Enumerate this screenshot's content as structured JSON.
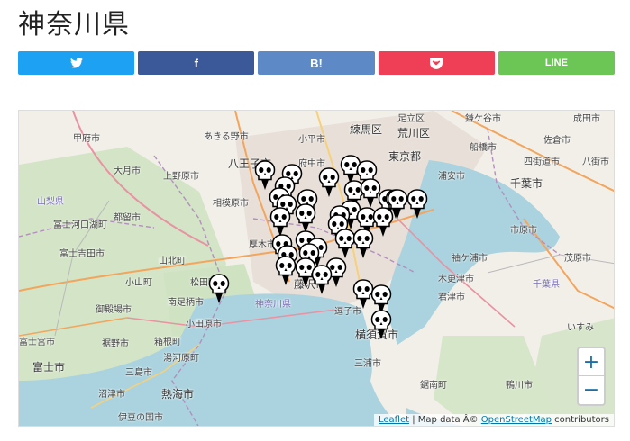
{
  "page": {
    "title": "神奈川県"
  },
  "share": {
    "twitter_label": "",
    "facebook_label": "f",
    "hatena_label": "B!",
    "pocket_label": "",
    "line_label": "LINE"
  },
  "map": {
    "zoom_in": "+",
    "zoom_out": "−",
    "attribution": {
      "leaflet": "Leaflet",
      "sep": " | Map data Â© ",
      "osm": "OpenStreetMap",
      "suffix": " contributors"
    },
    "labels": {
      "kofu": "甲府市",
      "akiruno": "あきる野市",
      "nerima": "練馬区",
      "adachi": "足立区",
      "kamagaya": "鎌ケ谷市",
      "narita": "成田市",
      "kodaira": "小平市",
      "arakawa": "荒川区",
      "hachioji": "八王子市",
      "fuchu": "府中市",
      "tokyo": "東京都",
      "funabashi": "船橋市",
      "sakura": "佐倉市",
      "otsuki": "大月市",
      "uenohara": "上野原市",
      "urayasu": "浦安市",
      "yotsukaido": "四街道市",
      "yachimata": "八街市",
      "chiba": "千葉市",
      "sagamihara": "相模原市",
      "yamanashi": "山梨県",
      "tsuru": "都留市",
      "fujikawaguchiko": "富士河口湖町",
      "fujiyoshida": "富士吉田市",
      "atsugi": "厚木市",
      "ichihara": "市原市",
      "sodegaura": "袖ケ浦市",
      "kisarazu": "木更津市",
      "mobara": "茂原市",
      "yamakita": "山北町",
      "matsuda": "松田町",
      "oyama": "小山町",
      "minamiashigara": "南足柄市",
      "fujisawa": "藤沢市",
      "kimitsu": "君津市",
      "chiba_pref": "千葉県",
      "gotemba": "御殿場市",
      "odawara": "小田原市",
      "kanagawa_pref": "神奈川県",
      "zushi": "逗子市",
      "isumi": "いすみ",
      "yokosuka": "横須賀市",
      "fujinomiya": "富士宮市",
      "susono": "裾野市",
      "hakone": "箱根町",
      "yugawara": "湯河原町",
      "fuji": "富士市",
      "miura": "三浦市",
      "mishima": "三島市",
      "numazu": "沼津市",
      "atami": "熱海市",
      "kamogawa": "鴨川市",
      "minamiboso": "鋸南町",
      "izunokuni": "伊豆の国市"
    },
    "markers": [
      "skull",
      "skull",
      "skull",
      "skull",
      "skull",
      "skull",
      "skull",
      "skull",
      "skull",
      "skull",
      "skull",
      "skull",
      "skull",
      "skull",
      "skull",
      "skull",
      "skull",
      "skull",
      "skull",
      "skull",
      "skull",
      "skull",
      "skull",
      "skull",
      "skull",
      "skull",
      "skull",
      "skull",
      "skull",
      "skull",
      "skull",
      "skull",
      "skull",
      "skull",
      "skull",
      "skull",
      "skull"
    ],
    "colors": {
      "sea": "#aad3df",
      "land": "#f2efe9",
      "forest": "#cfe3c2",
      "urban": "#e8e0d8"
    }
  }
}
